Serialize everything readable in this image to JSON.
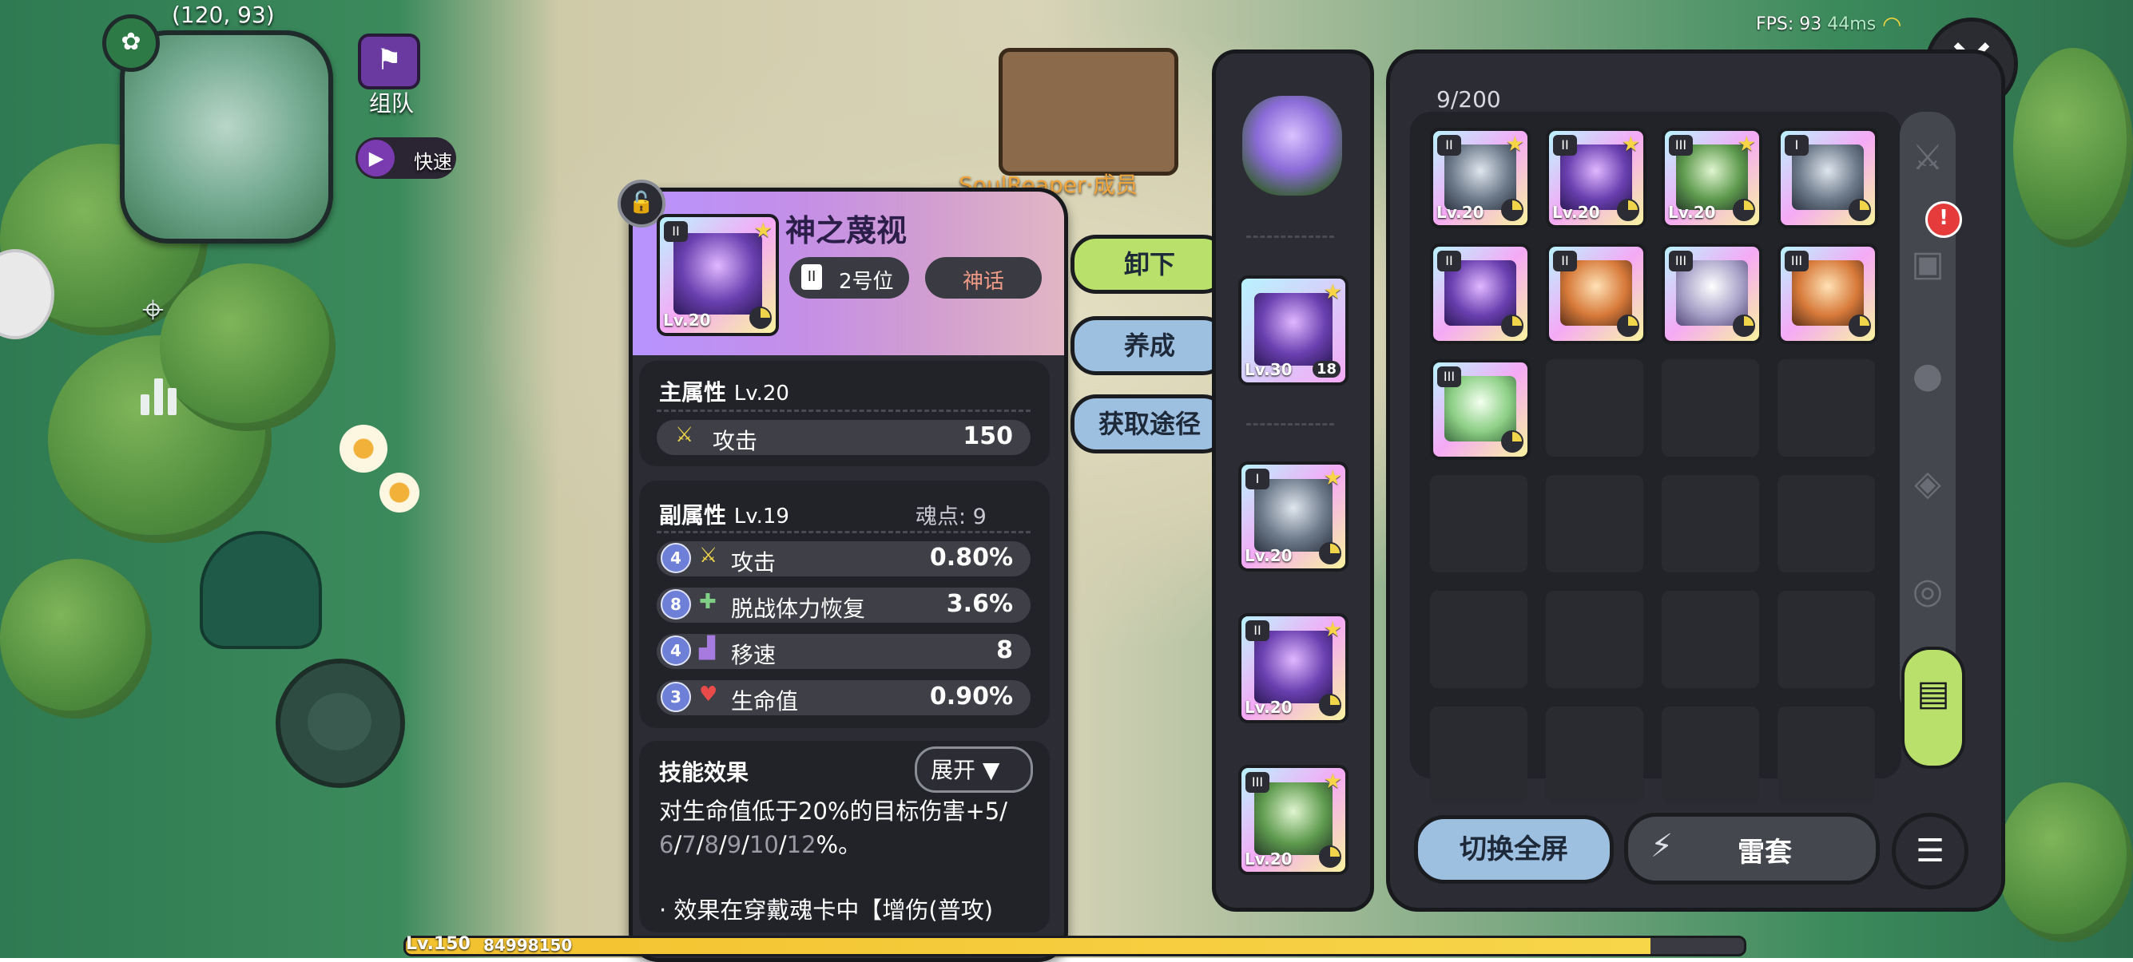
{
  "hud": {
    "coords": "(120, 93)",
    "team_label": "组队",
    "speed_label": "快速",
    "fps_label": "FPS: 93",
    "ping": "44ms",
    "npc_name": "SoulReaper·成员"
  },
  "detail": {
    "card_name": "神之蔑视",
    "card_tier": "II",
    "card_level": "Lv.20",
    "slot_label": "2号位",
    "slot_tier": "II",
    "rarity": "神话",
    "main_attr_title": "主属性",
    "main_attr_level": "Lv.20",
    "main_stat_name": "攻击",
    "main_stat_value": "150",
    "sub_attr_title": "副属性",
    "sub_attr_level": "Lv.19",
    "soul_points": "魂点: 9",
    "sub_stats": [
      {
        "rank": "4",
        "name": "攻击",
        "value": "0.80%"
      },
      {
        "rank": "8",
        "name": "脱战体力恢复",
        "value": "3.6%"
      },
      {
        "rank": "4",
        "name": "移速",
        "value": "8"
      },
      {
        "rank": "3",
        "name": "生命值",
        "value": "0.90%"
      }
    ],
    "skill_title": "技能效果",
    "expand_label": "展开",
    "desc_line1": "对生命值低于20%的目标伤害+5/",
    "desc_vals": [
      "6",
      "7",
      "8",
      "9",
      "10",
      "12"
    ],
    "desc_tail": "%。",
    "desc_line3": "· 效果在穿戴魂卡中【增伤(普攻)"
  },
  "actions": {
    "unequip": "卸下",
    "develop": "养成",
    "source": "获取途径"
  },
  "slots": [
    {
      "tier": "",
      "level": "Lv.30",
      "count": "18"
    },
    {
      "tier": "I",
      "level": "Lv.20"
    },
    {
      "tier": "II",
      "level": "Lv.20"
    },
    {
      "tier": "III",
      "level": "Lv.20"
    }
  ],
  "inventory": {
    "count": "9/200",
    "cards": [
      {
        "tier": "II",
        "level": "Lv.20",
        "art": "grey"
      },
      {
        "tier": "II",
        "level": "Lv.20",
        "art": "purple"
      },
      {
        "tier": "III",
        "level": "Lv.20",
        "art": "green"
      },
      {
        "tier": "I",
        "level": "",
        "art": "grey"
      },
      {
        "tier": "II",
        "level": "",
        "art": "purple"
      },
      {
        "tier": "II",
        "level": "",
        "art": "orange"
      },
      {
        "tier": "III",
        "level": "",
        "art": "multi"
      },
      {
        "tier": "III",
        "level": "",
        "art": "orange"
      },
      {
        "tier": "III",
        "level": "",
        "art": "leaf"
      }
    ],
    "fullscreen_label": "切换全屏",
    "set_label": "雷套",
    "notification": "!"
  },
  "player": {
    "level": "Lv.150",
    "xp": "84998150",
    "xp_progress": 0.93
  },
  "colors": {
    "accent_green": "#b8e06a",
    "accent_blue": "#9dbfe0",
    "rarity_mythic": "#f19a86",
    "panel": "#2c2d34"
  }
}
